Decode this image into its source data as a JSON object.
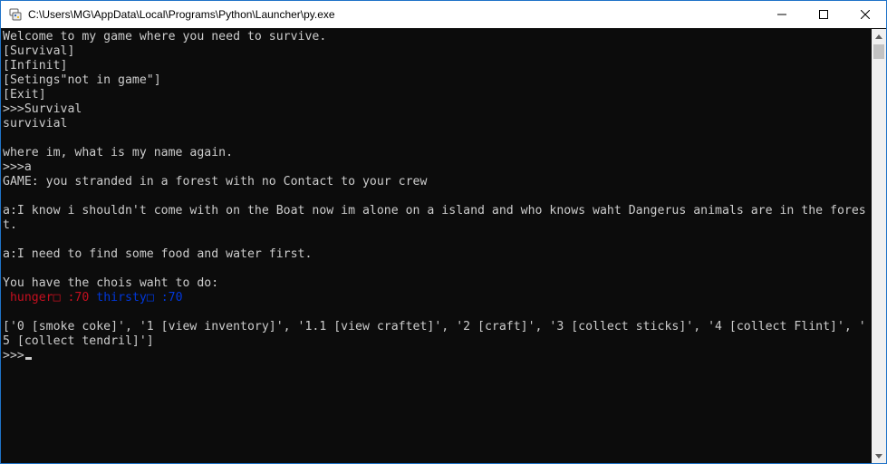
{
  "window": {
    "title": "C:\\Users\\MG\\AppData\\Local\\Programs\\Python\\Launcher\\py.exe",
    "icon": "python-launcher-icon",
    "controls": [
      "minimize-icon",
      "maximize-icon",
      "close-icon"
    ]
  },
  "console": {
    "colors": {
      "text": "#cccccc",
      "background": "#0c0c0c",
      "hunger": "#c50f1f",
      "thirsty": "#0037da"
    },
    "lines": [
      "Welcome to my game where you need to survive.",
      "[Survival]",
      "[Infinit]",
      "[Setings\"not in game\"]",
      "[Exit]",
      ">>>Survival",
      "survivial",
      "",
      "where im, what is my name again.",
      ">>>a",
      "GAME: you stranded in a forest with no Contact to your crew",
      "",
      "a:I know i shouldn't come with on the Boat now im alone on a island and who knows waht Dangerus animals are in the fores",
      "t.",
      "",
      "a:I need to find some food and water first.",
      "",
      "You have the chois waht to do:"
    ],
    "stats": {
      "hunger_label": "hunger□ :70",
      "thirsty_label": "thirsty□ :70"
    },
    "options_lines": [
      "['0 [smoke coke]', '1 [view inventory]', '1.1 [view craftet]', '2 [craft]', '3 [collect sticks]', '4 [collect Flint]', '",
      "5 [collect tendril]']"
    ],
    "prompt": ">>>"
  }
}
